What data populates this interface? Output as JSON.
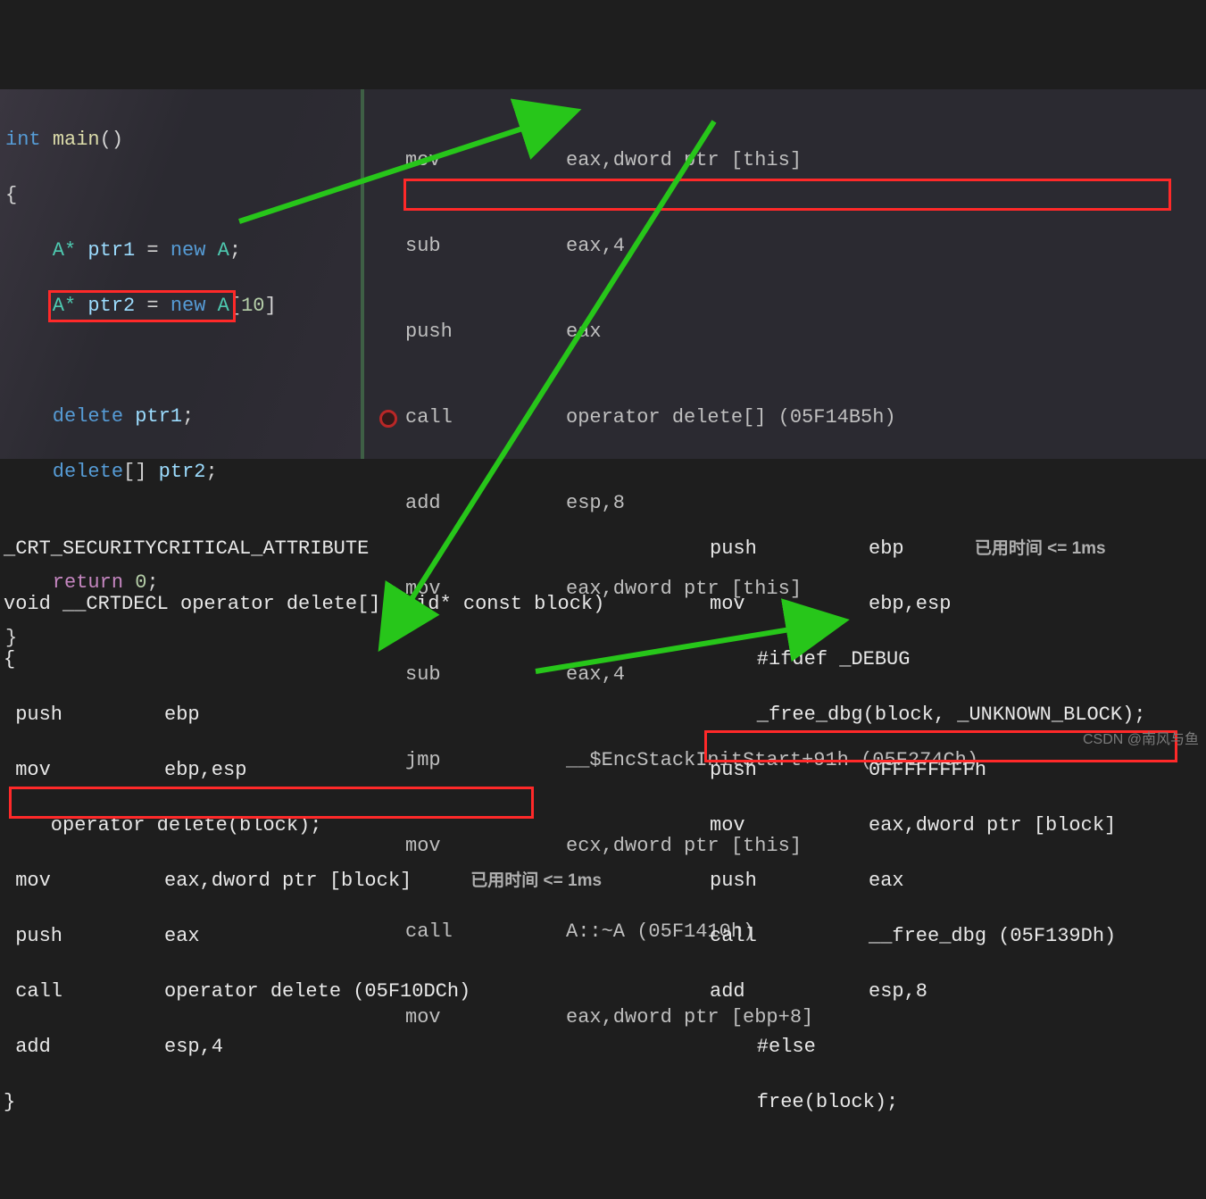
{
  "editor": {
    "sig_type": "int",
    "sig_name": "main",
    "sig_paren": "()",
    "brace_open": "{",
    "l1_seg1": "    A* ",
    "l1_var": "ptr1",
    "l1_eq": " = ",
    "l1_kw": "new",
    "l1_type": " A",
    "l1_end": ";",
    "l2_seg1": "    A* ",
    "l2_var": "ptr2",
    "l2_eq": " = ",
    "l2_kw": "new",
    "l2_type": " A",
    "l2_br": "[",
    "l2_num": "10",
    "l2_br2": "]",
    "l3_kw": "    delete",
    "l3_sp": " ",
    "l3_var": "ptr1",
    "l3_end": ";",
    "l4_kw": "    delete",
    "l4_br": "[] ",
    "l4_var": "ptr2",
    "l4_end": ";",
    "ret_kw": "    return ",
    "ret_val": "0",
    "ret_end": ";",
    "brace_close": "}"
  },
  "disasm": {
    "r0_op": "mov",
    "r0_arg": "eax,dword ptr [this]",
    "r1_op": "sub",
    "r1_arg": "eax,4",
    "r2_op": "push",
    "r2_arg": "eax",
    "r3_op": "call",
    "r3_arg": "operator delete[] (05F14B5h)",
    "r4_op": "add",
    "r4_arg": "esp,8",
    "r5_op": "mov",
    "r5_arg": "eax,dword ptr [this]",
    "r6_op": "sub",
    "r6_arg": "eax,4",
    "r7_op": "jmp",
    "r7_arg": "__$EncStackInitStart+91h (05F274Ch)",
    "r8_op": "mov",
    "r8_arg": "ecx,dword ptr [this]",
    "r9_op": "call",
    "r9_arg": "A::~A (05F1410h)",
    "r10_op": "mov",
    "r10_arg": "eax,dword ptr [ebp+8]"
  },
  "bottom_left": {
    "l0": "_CRT_SECURITYCRITICAL_ATTRIBUTE",
    "l1": "void __CRTDECL operator delete[](void* const block)",
    "l2": "{",
    "l3_op": " push",
    "l3_arg": "ebp",
    "l4_op": " mov",
    "l4_arg": "ebp,esp",
    "l5": "    operator delete(block);",
    "l6_op": " mov",
    "l6_arg": "eax,dword ptr [block]",
    "l7_op": " push",
    "l7_arg": "eax",
    "l8_op": " call",
    "l8_arg": "operator delete (05F10DCh)",
    "l9_op": " add",
    "l9_arg": "esp,4",
    "l10": "}",
    "perf": "已用时间 <= 1ms"
  },
  "bottom_right": {
    "r0_op": "push",
    "r0_arg": "ebp",
    "r1_op": "mov",
    "r1_arg": "ebp,esp",
    "r2": "    #ifdef _DEBUG",
    "r3": "    _free_dbg(block, _UNKNOWN_BLOCK);",
    "r4_op": "push",
    "r4_arg": "0FFFFFFFFh",
    "r5_op": "mov",
    "r5_arg": "eax,dword ptr [block]",
    "r6_op": "push",
    "r6_arg": "eax",
    "r7_op": "call",
    "r7_arg": "__free_dbg (05F139Dh)",
    "r8_op": "add",
    "r8_arg": "esp,8",
    "r9": "    #else",
    "r10": "    free(block);",
    "perf": "已用时间 <= 1ms"
  },
  "watermark": "CSDN @南风与鱼"
}
